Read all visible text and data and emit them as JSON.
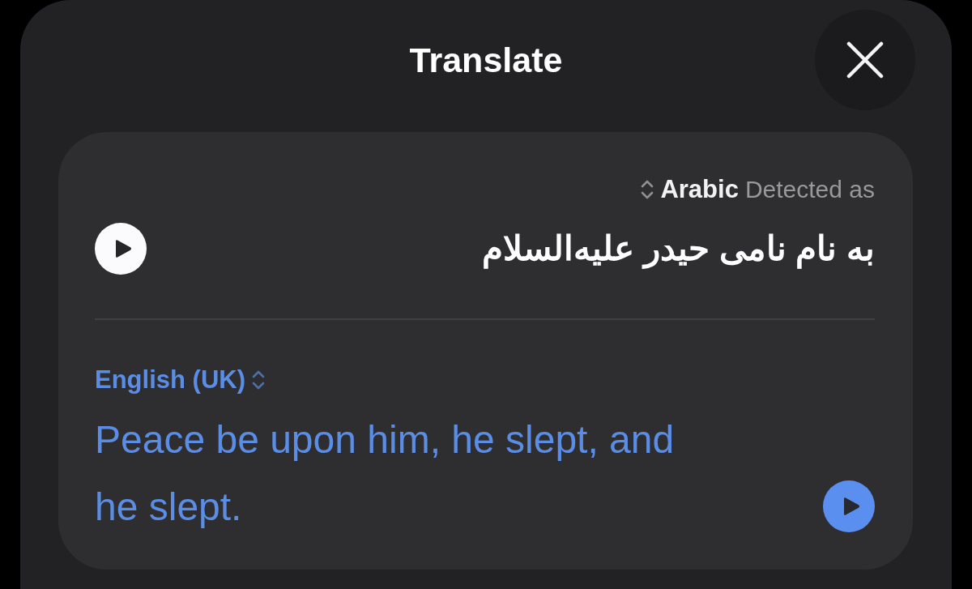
{
  "title": "Translate",
  "source": {
    "language": "Arabic",
    "detected_label": "Detected as",
    "text": "به نام نامی حیدر علیه‌السلام"
  },
  "target": {
    "language": "English (UK)",
    "text": "Peace be upon him, he slept, and he slept."
  }
}
